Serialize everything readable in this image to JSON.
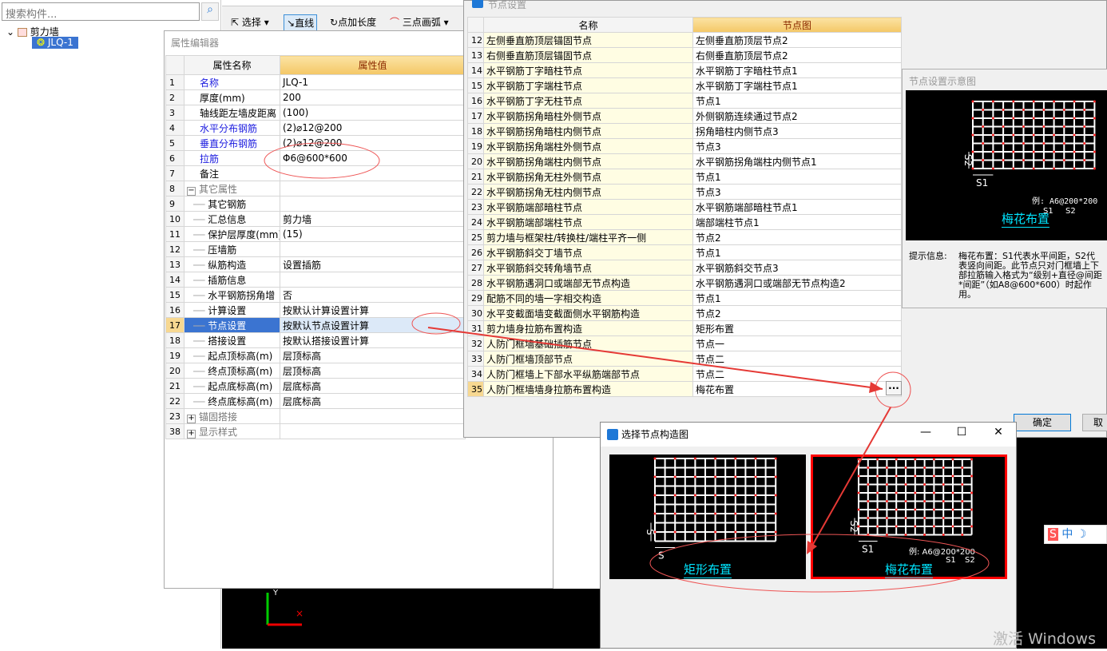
{
  "left_panel": {
    "search_placeholder": "搜索构件...",
    "tree": {
      "root": "剪力墙",
      "child": "JLQ-1"
    }
  },
  "toolbar": {
    "select": "选择",
    "line": "直线",
    "point_length": "点加长度",
    "arc": "三点画弧"
  },
  "property_editor": {
    "title": "属性编辑器",
    "col_name": "属性名称",
    "col_value": "属性值",
    "rows": [
      {
        "n": "1",
        "name": "名称",
        "value": "JLQ-1",
        "blue": true
      },
      {
        "n": "2",
        "name": "厚度(mm)",
        "value": "200"
      },
      {
        "n": "3",
        "name": "轴线距左墙皮距离",
        "value": "(100)"
      },
      {
        "n": "4",
        "name": "水平分布钢筋",
        "value": "(2)⌀12@200",
        "blue": true
      },
      {
        "n": "5",
        "name": "垂直分布钢筋",
        "value": "(2)⌀12@200",
        "blue": true
      },
      {
        "n": "6",
        "name": "拉筋",
        "value": "Φ6@600*600",
        "blue": true
      },
      {
        "n": "7",
        "name": "备注",
        "value": ""
      },
      {
        "n": "8",
        "name": "其它属性",
        "value": "",
        "group": true
      },
      {
        "n": "9",
        "name": "其它钢筋",
        "value": "",
        "child": true
      },
      {
        "n": "10",
        "name": "汇总信息",
        "value": "剪力墙",
        "child": true
      },
      {
        "n": "11",
        "name": "保护层厚度(mm)",
        "value": "(15)",
        "child": true
      },
      {
        "n": "12",
        "name": "压墙筋",
        "value": "",
        "child": true
      },
      {
        "n": "13",
        "name": "纵筋构造",
        "value": "设置插筋",
        "child": true
      },
      {
        "n": "14",
        "name": "插筋信息",
        "value": "",
        "child": true
      },
      {
        "n": "15",
        "name": "水平钢筋拐角增",
        "value": "否",
        "child": true
      },
      {
        "n": "16",
        "name": "计算设置",
        "value": "按默认计算设置计算",
        "child": true
      },
      {
        "n": "17",
        "name": "节点设置",
        "value": "按默认节点设置计算",
        "child": true,
        "selected": true
      },
      {
        "n": "18",
        "name": "搭接设置",
        "value": "按默认搭接设置计算",
        "child": true
      },
      {
        "n": "19",
        "name": "起点顶标高(m)",
        "value": "层顶标高",
        "child": true
      },
      {
        "n": "20",
        "name": "终点顶标高(m)",
        "value": "层顶标高",
        "child": true
      },
      {
        "n": "21",
        "name": "起点底标高(m)",
        "value": "层底标高",
        "child": true
      },
      {
        "n": "22",
        "name": "终点底标高(m)",
        "value": "层底标高",
        "child": true
      },
      {
        "n": "23",
        "name": "锚固搭接",
        "value": "",
        "group": true,
        "collapsed": true
      },
      {
        "n": "38",
        "name": "显示样式",
        "value": "",
        "group": true,
        "collapsed": true
      }
    ]
  },
  "node_dialog": {
    "title": "节点设置",
    "col_name": "名称",
    "col_node": "节点图",
    "rows": [
      {
        "n": "12",
        "name": "左侧垂直筋顶层锚固节点",
        "node": "左侧垂直筋顶层节点2"
      },
      {
        "n": "13",
        "name": "右侧垂直筋顶层锚固节点",
        "node": "右侧垂直筋顶层节点2"
      },
      {
        "n": "14",
        "name": "水平钢筋丁字暗柱节点",
        "node": "水平钢筋丁字暗柱节点1"
      },
      {
        "n": "15",
        "name": "水平钢筋丁字端柱节点",
        "node": "水平钢筋丁字端柱节点1"
      },
      {
        "n": "16",
        "name": "水平钢筋丁字无柱节点",
        "node": "节点1"
      },
      {
        "n": "17",
        "name": "水平钢筋拐角暗柱外侧节点",
        "node": "外侧钢筋连续通过节点2"
      },
      {
        "n": "18",
        "name": "水平钢筋拐角暗柱内侧节点",
        "node": "拐角暗柱内侧节点3"
      },
      {
        "n": "19",
        "name": "水平钢筋拐角端柱外侧节点",
        "node": "节点3"
      },
      {
        "n": "20",
        "name": "水平钢筋拐角端柱内侧节点",
        "node": "水平钢筋拐角端柱内侧节点1"
      },
      {
        "n": "21",
        "name": "水平钢筋拐角无柱外侧节点",
        "node": "节点1"
      },
      {
        "n": "22",
        "name": "水平钢筋拐角无柱内侧节点",
        "node": "节点3"
      },
      {
        "n": "23",
        "name": "水平钢筋端部暗柱节点",
        "node": "水平钢筋端部暗柱节点1"
      },
      {
        "n": "24",
        "name": "水平钢筋端部端柱节点",
        "node": "端部端柱节点1"
      },
      {
        "n": "25",
        "name": "剪力墙与框架柱/转换柱/端柱平齐一侧",
        "node": "节点2"
      },
      {
        "n": "26",
        "name": "水平钢筋斜交丁墙节点",
        "node": "节点1"
      },
      {
        "n": "27",
        "name": "水平钢筋斜交转角墙节点",
        "node": "水平钢筋斜交节点3"
      },
      {
        "n": "28",
        "name": "水平钢筋遇洞口或端部无节点构造",
        "node": "水平钢筋遇洞口或端部无节点构造2"
      },
      {
        "n": "29",
        "name": "配筋不同的墙一字相交构造",
        "node": "节点1"
      },
      {
        "n": "30",
        "name": "水平变截面墙变截面侧水平钢筋构造",
        "node": "节点2"
      },
      {
        "n": "31",
        "name": "剪力墙身拉筋布置构造",
        "node": "矩形布置"
      },
      {
        "n": "32",
        "name": "人防门框墙基础插筋节点",
        "node": "节点一"
      },
      {
        "n": "33",
        "name": "人防门框墙顶部节点",
        "node": "节点二"
      },
      {
        "n": "34",
        "name": "人防门框墙上下部水平纵筋端部节点",
        "node": "节点二"
      },
      {
        "n": "35",
        "name": "人防门框墙墙身拉筋布置构造",
        "node": "梅花布置",
        "selected": true
      }
    ],
    "ellipsis": "...",
    "preview_title": "节点设置示意图",
    "preview": {
      "example": "例: A6@200*200",
      "s1": "S1",
      "s2": "S2",
      "caption": "梅花布置"
    },
    "hint_label": "提示信息:",
    "hint_text": "梅花布置：S1代表水平间距，S2代表竖向间距。此节点只对门框墙上下部拉筋输入格式为“级别+直径@间距*间距”（如A8@600*600）时起作用。",
    "ok": "确定",
    "cancel": "取"
  },
  "select_dialog": {
    "title": "选择节点构造图",
    "options": [
      {
        "caption": "矩形布置",
        "s": "S",
        "selected": false
      },
      {
        "caption": "梅花布置",
        "s1": "S1",
        "s2": "S2",
        "example": "例: A6@200*200",
        "selected": true
      }
    ]
  },
  "ime": {
    "label": "中"
  },
  "watermark": "激活 Windows",
  "colors": {
    "annotation": "#e53935",
    "selected_blue": "#3b74d1",
    "header_gold": "#f4c766",
    "caption_cyan": "#00e5ff"
  }
}
